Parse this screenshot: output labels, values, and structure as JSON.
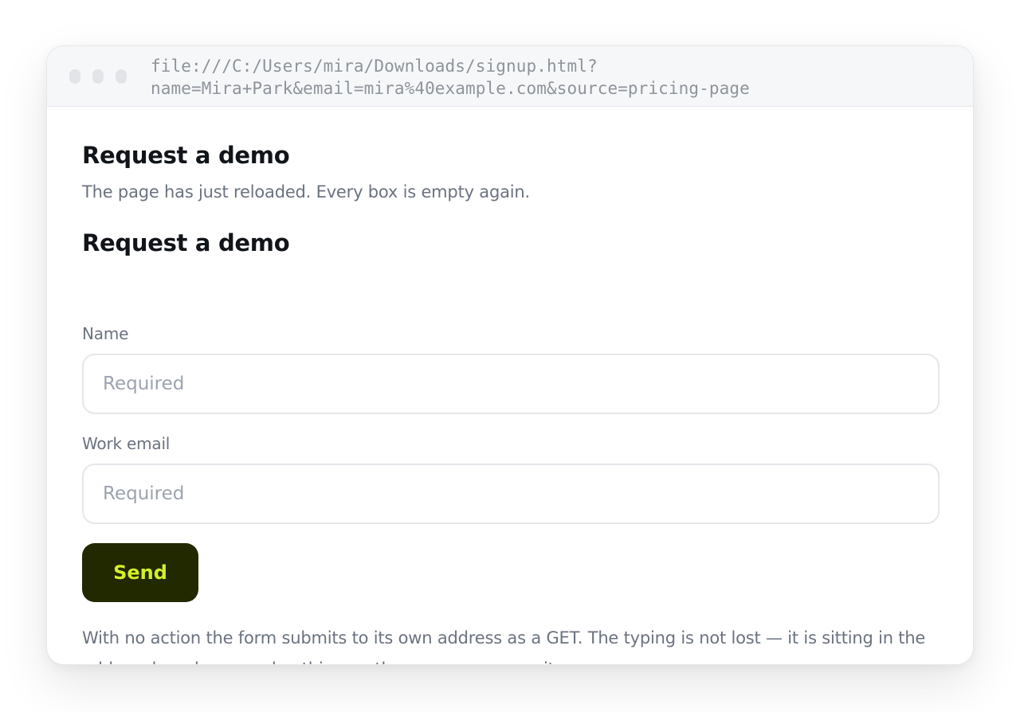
{
  "browser": {
    "address_line1": "file:///C:/Users/mira/Downloads/signup.html?",
    "address_line2": "name=Mira+Park&email=mira%40example.com&source=pricing-page"
  },
  "page": {
    "heading_top": "Request a demo",
    "reload_note": "The page has just reloaded. Every box is empty again.",
    "form_heading": "Request a demo",
    "fields": [
      {
        "label": "Name",
        "value": "",
        "placeholder": "Required"
      },
      {
        "label": "Work email",
        "value": "",
        "placeholder": "Required"
      }
    ],
    "send_label": "Send",
    "footnote": "With no action the form submits to its own address as a GET. The typing is not lost — it is sitting in the address bar above, and nothing on the server ever saw it."
  },
  "colors": {
    "button_bg": "#222800",
    "button_text": "#d4ef2c"
  }
}
